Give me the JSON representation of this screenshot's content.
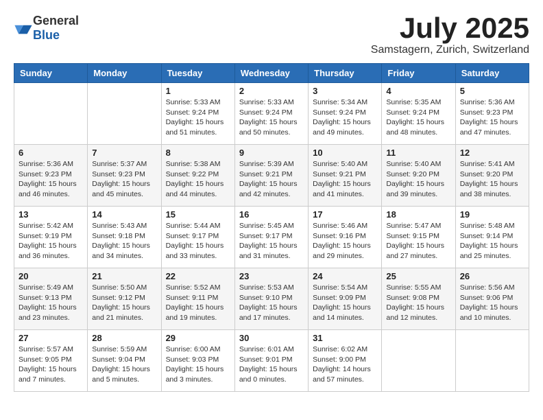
{
  "header": {
    "logo_general": "General",
    "logo_blue": "Blue",
    "month_title": "July 2025",
    "subtitle": "Samstagern, Zurich, Switzerland"
  },
  "weekdays": [
    "Sunday",
    "Monday",
    "Tuesday",
    "Wednesday",
    "Thursday",
    "Friday",
    "Saturday"
  ],
  "weeks": [
    [
      {
        "day": "",
        "info": ""
      },
      {
        "day": "",
        "info": ""
      },
      {
        "day": "1",
        "info": "Sunrise: 5:33 AM\nSunset: 9:24 PM\nDaylight: 15 hours and 51 minutes."
      },
      {
        "day": "2",
        "info": "Sunrise: 5:33 AM\nSunset: 9:24 PM\nDaylight: 15 hours and 50 minutes."
      },
      {
        "day": "3",
        "info": "Sunrise: 5:34 AM\nSunset: 9:24 PM\nDaylight: 15 hours and 49 minutes."
      },
      {
        "day": "4",
        "info": "Sunrise: 5:35 AM\nSunset: 9:24 PM\nDaylight: 15 hours and 48 minutes."
      },
      {
        "day": "5",
        "info": "Sunrise: 5:36 AM\nSunset: 9:23 PM\nDaylight: 15 hours and 47 minutes."
      }
    ],
    [
      {
        "day": "6",
        "info": "Sunrise: 5:36 AM\nSunset: 9:23 PM\nDaylight: 15 hours and 46 minutes."
      },
      {
        "day": "7",
        "info": "Sunrise: 5:37 AM\nSunset: 9:23 PM\nDaylight: 15 hours and 45 minutes."
      },
      {
        "day": "8",
        "info": "Sunrise: 5:38 AM\nSunset: 9:22 PM\nDaylight: 15 hours and 44 minutes."
      },
      {
        "day": "9",
        "info": "Sunrise: 5:39 AM\nSunset: 9:21 PM\nDaylight: 15 hours and 42 minutes."
      },
      {
        "day": "10",
        "info": "Sunrise: 5:40 AM\nSunset: 9:21 PM\nDaylight: 15 hours and 41 minutes."
      },
      {
        "day": "11",
        "info": "Sunrise: 5:40 AM\nSunset: 9:20 PM\nDaylight: 15 hours and 39 minutes."
      },
      {
        "day": "12",
        "info": "Sunrise: 5:41 AM\nSunset: 9:20 PM\nDaylight: 15 hours and 38 minutes."
      }
    ],
    [
      {
        "day": "13",
        "info": "Sunrise: 5:42 AM\nSunset: 9:19 PM\nDaylight: 15 hours and 36 minutes."
      },
      {
        "day": "14",
        "info": "Sunrise: 5:43 AM\nSunset: 9:18 PM\nDaylight: 15 hours and 34 minutes."
      },
      {
        "day": "15",
        "info": "Sunrise: 5:44 AM\nSunset: 9:17 PM\nDaylight: 15 hours and 33 minutes."
      },
      {
        "day": "16",
        "info": "Sunrise: 5:45 AM\nSunset: 9:17 PM\nDaylight: 15 hours and 31 minutes."
      },
      {
        "day": "17",
        "info": "Sunrise: 5:46 AM\nSunset: 9:16 PM\nDaylight: 15 hours and 29 minutes."
      },
      {
        "day": "18",
        "info": "Sunrise: 5:47 AM\nSunset: 9:15 PM\nDaylight: 15 hours and 27 minutes."
      },
      {
        "day": "19",
        "info": "Sunrise: 5:48 AM\nSunset: 9:14 PM\nDaylight: 15 hours and 25 minutes."
      }
    ],
    [
      {
        "day": "20",
        "info": "Sunrise: 5:49 AM\nSunset: 9:13 PM\nDaylight: 15 hours and 23 minutes."
      },
      {
        "day": "21",
        "info": "Sunrise: 5:50 AM\nSunset: 9:12 PM\nDaylight: 15 hours and 21 minutes."
      },
      {
        "day": "22",
        "info": "Sunrise: 5:52 AM\nSunset: 9:11 PM\nDaylight: 15 hours and 19 minutes."
      },
      {
        "day": "23",
        "info": "Sunrise: 5:53 AM\nSunset: 9:10 PM\nDaylight: 15 hours and 17 minutes."
      },
      {
        "day": "24",
        "info": "Sunrise: 5:54 AM\nSunset: 9:09 PM\nDaylight: 15 hours and 14 minutes."
      },
      {
        "day": "25",
        "info": "Sunrise: 5:55 AM\nSunset: 9:08 PM\nDaylight: 15 hours and 12 minutes."
      },
      {
        "day": "26",
        "info": "Sunrise: 5:56 AM\nSunset: 9:06 PM\nDaylight: 15 hours and 10 minutes."
      }
    ],
    [
      {
        "day": "27",
        "info": "Sunrise: 5:57 AM\nSunset: 9:05 PM\nDaylight: 15 hours and 7 minutes."
      },
      {
        "day": "28",
        "info": "Sunrise: 5:59 AM\nSunset: 9:04 PM\nDaylight: 15 hours and 5 minutes."
      },
      {
        "day": "29",
        "info": "Sunrise: 6:00 AM\nSunset: 9:03 PM\nDaylight: 15 hours and 3 minutes."
      },
      {
        "day": "30",
        "info": "Sunrise: 6:01 AM\nSunset: 9:01 PM\nDaylight: 15 hours and 0 minutes."
      },
      {
        "day": "31",
        "info": "Sunrise: 6:02 AM\nSunset: 9:00 PM\nDaylight: 14 hours and 57 minutes."
      },
      {
        "day": "",
        "info": ""
      },
      {
        "day": "",
        "info": ""
      }
    ]
  ]
}
